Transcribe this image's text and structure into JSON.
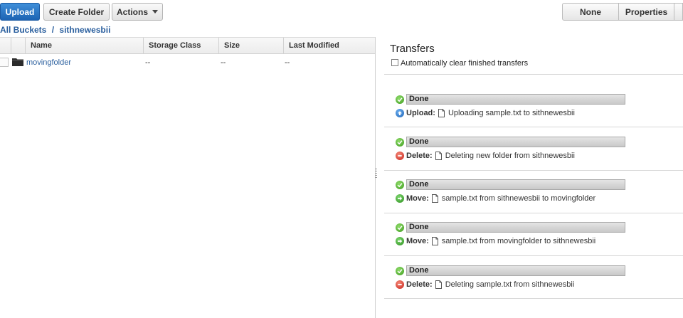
{
  "toolbar": {
    "upload_label": "Upload",
    "create_folder_label": "Create Folder",
    "actions_label": "Actions",
    "none_label": "None",
    "properties_label": "Properties"
  },
  "breadcrumb": {
    "root": "All Buckets",
    "separator": "/",
    "bucket": "sithnewesbii"
  },
  "table": {
    "columns": [
      "Name",
      "Storage Class",
      "Size",
      "Last Modified"
    ],
    "rows": [
      {
        "name": "movingfolder",
        "storage_class": "--",
        "size": "--",
        "last_modified": "--",
        "icon": "folder-icon"
      }
    ]
  },
  "transfers": {
    "title": "Transfers",
    "auto_clear_label": "Automatically clear finished transfers",
    "auto_clear_checked": false,
    "items": [
      {
        "status": "Done",
        "action": "Upload:",
        "action_icon": "upload-icon",
        "detail": "Uploading sample.txt to sithnewesbii"
      },
      {
        "status": "Done",
        "action": "Delete:",
        "action_icon": "delete-icon",
        "detail": "Deleting new folder from sithnewesbii"
      },
      {
        "status": "Done",
        "action": "Move:",
        "action_icon": "move-icon",
        "detail": "sample.txt from sithnewesbii to movingfolder"
      },
      {
        "status": "Done",
        "action": "Move:",
        "action_icon": "move-icon",
        "detail": "sample.txt from movingfolder to sithnewesbii"
      },
      {
        "status": "Done",
        "action": "Delete:",
        "action_icon": "delete-icon",
        "detail": "Deleting sample.txt from sithnewesbii"
      }
    ]
  },
  "colors": {
    "primary_button": "#1d63b3",
    "link": "#2a5f9e",
    "status_done": "#3c9a1c",
    "delete": "#c8231a"
  }
}
